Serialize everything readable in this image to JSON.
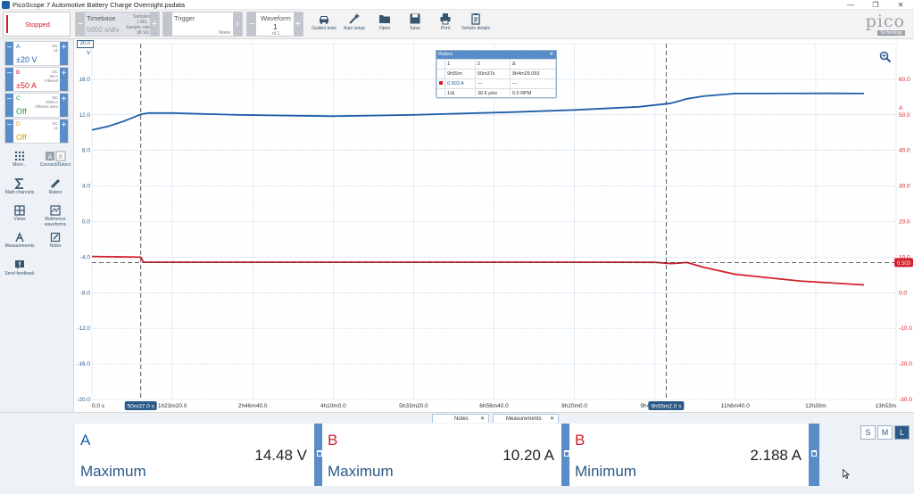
{
  "window": {
    "title": "PicoScope 7 Automotive Battery Charge Overnight.psdata",
    "minimize": "—",
    "restore": "❐",
    "close": "✕"
  },
  "toolbar": {
    "stop_label": "Stopped",
    "timebase": {
      "label": "Timebase",
      "value": "5000 s/div",
      "samples_label": "Samples",
      "samples_value": "1 MS",
      "rate_label": "Sample rate",
      "rate_value": "38 S/s"
    },
    "trigger": {
      "label": "Trigger",
      "mode": "None"
    },
    "waveform": {
      "label": "Waveform",
      "value": "1",
      "of": "of 1"
    },
    "tools": [
      {
        "label": "Guided tests",
        "icon": "car-icon"
      },
      {
        "label": "Auto setup",
        "icon": "wand-icon"
      },
      {
        "label": "Open",
        "icon": "folder-icon"
      },
      {
        "label": "Save",
        "icon": "save-icon"
      },
      {
        "label": "Print",
        "icon": "printer-icon"
      },
      {
        "label": "Vehicle details",
        "icon": "clipboard-icon"
      }
    ],
    "logo_text": "pico",
    "logo_sub": "Technology"
  },
  "channels": [
    {
      "name": "A",
      "coupling": "DC",
      "probe": "x1",
      "extra": "",
      "range": "±20 V",
      "color": "#1f5fa8"
    },
    {
      "name": "B",
      "coupling": "DC",
      "probe": "60 A",
      "extra": "Filtered",
      "range": "±50 A",
      "color": "#d21f2b"
    },
    {
      "name": "C",
      "coupling": "DC",
      "probe": "2000 A",
      "extra": "Filtered Zero",
      "range": "Off",
      "color": "#2e9e3a"
    },
    {
      "name": "D",
      "coupling": "DC",
      "probe": "x1",
      "extra": "",
      "range": "Off",
      "color": "#d9a300"
    }
  ],
  "sidebar_tools": [
    {
      "label": "More...",
      "icon": "grid-dots-icon"
    },
    {
      "label": "Connect/Detect",
      "icon": "ab-icon"
    },
    {
      "label": "Math channels",
      "icon": "sigma-icon"
    },
    {
      "label": "Rulers",
      "icon": "ruler-icon"
    },
    {
      "label": "Views",
      "icon": "views-icon"
    },
    {
      "label": "Reference waveforms",
      "icon": "reference-icon"
    },
    {
      "label": "Measurements",
      "icon": "measure-icon"
    },
    {
      "label": "Notes",
      "icon": "notes-icon"
    },
    {
      "label": "Send feedback",
      "icon": "feedback-icon"
    }
  ],
  "chart_data": {
    "type": "line",
    "title": "",
    "xlabel": "",
    "ylabel": "V",
    "ylabel_right": "A",
    "x_ticks": [
      "0.0 s",
      "1h23m20.0",
      "2h46m40.0",
      "4h10m0.0",
      "5h33m20.0",
      "6h56m40.0",
      "8h20m0.0",
      "9h43m20.0",
      "11h6m40.0",
      "12h30m",
      "13h53m"
    ],
    "y_ticks_left": [
      "20.0",
      "16.0",
      "12.0",
      "8.0",
      "4.0",
      "0.0",
      "-4.0",
      "-8.0",
      "-12.0",
      "-16.0",
      "-20.0"
    ],
    "y_ticks_right": [
      "60.0",
      "50.0",
      "40.0",
      "30.0",
      "20.0",
      "10.0",
      "0.0",
      "-10.0",
      "-20.0",
      "-30.0"
    ],
    "x_range_s": [
      0,
      50000
    ],
    "ylim_left": [
      -20,
      20
    ],
    "ylim_right": [
      -30,
      70
    ],
    "grid": true,
    "series": [
      {
        "name": "A",
        "unit": "V",
        "axis": "left",
        "color": "#1f5fa8",
        "x": [
          0,
          1000,
          2000,
          3037,
          3500,
          5000,
          9000,
          15000,
          20000,
          26000,
          30000,
          34000,
          36000,
          37000,
          38000,
          40000,
          46000,
          48000
        ],
        "y": [
          10.3,
          10.7,
          11.3,
          12.05,
          12.2,
          12.2,
          12.0,
          11.85,
          12.0,
          12.3,
          12.55,
          12.9,
          13.3,
          13.8,
          14.1,
          14.4,
          14.42,
          14.4
        ]
      },
      {
        "name": "B",
        "unit": "A",
        "axis": "right",
        "color": "#d21f2b",
        "x": [
          0,
          3037,
          3200,
          10000,
          20000,
          30000,
          35000,
          36000,
          37000,
          38000,
          40000,
          44000,
          48000
        ],
        "y": [
          10.2,
          10.0,
          8.6,
          8.6,
          8.6,
          8.6,
          8.55,
          8.2,
          8.5,
          7.2,
          5.2,
          3.3,
          2.2
        ]
      }
    ],
    "rulers": {
      "x1_label": "50m37.0 s",
      "x2_label": "9h55m2.0 s",
      "x1_s": 3037,
      "x2_s": 35702,
      "y_value_label": "0.503",
      "y_value": 8.5
    }
  },
  "range_badge": "20.0",
  "rulers_table": {
    "title": "Rulers",
    "close": "✕",
    "headers": [
      "1",
      "2",
      "Δ"
    ],
    "time_row": [
      "9h55m",
      "50m37s",
      "9h4m25.093"
    ],
    "ch_row": [
      "0.503 A",
      "---",
      "---"
    ],
    "freq_row": [
      "1/Δ",
      "30.6 µHz",
      "0.0 RPM"
    ]
  },
  "bottom_tabs": [
    {
      "label": "Notes",
      "close": "✕"
    },
    {
      "label": "Measurements",
      "close": "✕"
    }
  ],
  "measurements": [
    {
      "channel": "A",
      "type": "Maximum",
      "value": "14.48 V",
      "color": "#1f5fa8"
    },
    {
      "channel": "B",
      "type": "Maximum",
      "value": "10.20 A",
      "color": "#d21f2b"
    },
    {
      "channel": "B",
      "type": "Minimum",
      "value": "2.188 A",
      "color": "#d21f2b"
    }
  ],
  "size_buttons": [
    "S",
    "M",
    "L"
  ]
}
